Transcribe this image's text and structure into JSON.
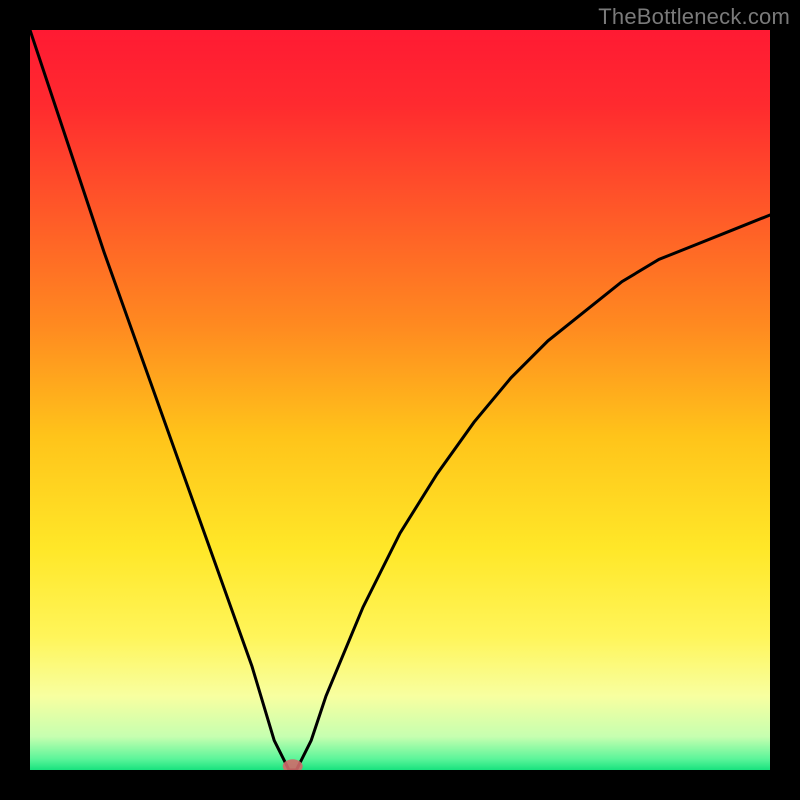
{
  "watermark": "TheBottleneck.com",
  "chart_data": {
    "type": "line",
    "title": "",
    "xlabel": "",
    "ylabel": "",
    "xlim": [
      0,
      100
    ],
    "ylim": [
      0,
      100
    ],
    "series": [
      {
        "name": "bottleneck-curve",
        "x": [
          0,
          5,
          10,
          15,
          20,
          25,
          30,
          33,
          35,
          36,
          38,
          40,
          45,
          50,
          55,
          60,
          65,
          70,
          75,
          80,
          85,
          90,
          95,
          100
        ],
        "y": [
          100,
          85,
          70,
          56,
          42,
          28,
          14,
          4,
          0,
          0,
          4,
          10,
          22,
          32,
          40,
          47,
          53,
          58,
          62,
          66,
          69,
          71,
          73,
          75
        ]
      }
    ],
    "marker": {
      "x": 35.5,
      "y": 0.5
    },
    "gradient_stops": [
      {
        "pos": 0.0,
        "color": "#ff1a33"
      },
      {
        "pos": 0.1,
        "color": "#ff2a2f"
      },
      {
        "pos": 0.25,
        "color": "#ff5a28"
      },
      {
        "pos": 0.4,
        "color": "#ff8a20"
      },
      {
        "pos": 0.55,
        "color": "#ffc41a"
      },
      {
        "pos": 0.7,
        "color": "#ffe728"
      },
      {
        "pos": 0.82,
        "color": "#fff55a"
      },
      {
        "pos": 0.9,
        "color": "#f8ffa0"
      },
      {
        "pos": 0.955,
        "color": "#c6ffb0"
      },
      {
        "pos": 0.985,
        "color": "#5cf59a"
      },
      {
        "pos": 1.0,
        "color": "#18e27e"
      }
    ]
  }
}
